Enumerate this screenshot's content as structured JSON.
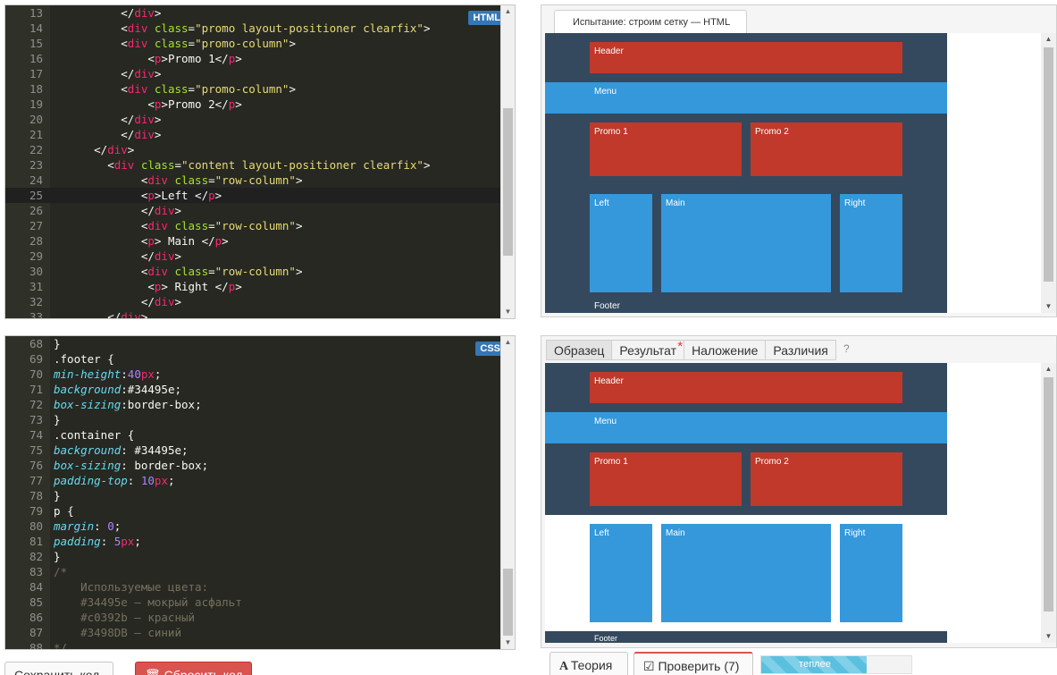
{
  "html_editor": {
    "badge": "HTML",
    "lines": [
      {
        "n": "13",
        "tokens": [
          [
            "t-text",
            "          </"
          ],
          [
            "t-tag",
            "div"
          ],
          [
            "t-text",
            ">"
          ]
        ]
      },
      {
        "n": "14",
        "tokens": [
          [
            "t-text",
            "          <"
          ],
          [
            "t-tag",
            "div"
          ],
          [
            "t-text",
            " "
          ],
          [
            "t-attr",
            "class"
          ],
          [
            "t-text",
            "="
          ],
          [
            "t-str",
            "\"promo layout-positioner clearfix\""
          ],
          [
            "t-text",
            ">"
          ]
        ]
      },
      {
        "n": "15",
        "tokens": [
          [
            "t-text",
            "          <"
          ],
          [
            "t-tag",
            "div"
          ],
          [
            "t-text",
            " "
          ],
          [
            "t-attr",
            "class"
          ],
          [
            "t-text",
            "="
          ],
          [
            "t-str",
            "\"promo-column\""
          ],
          [
            "t-text",
            ">"
          ]
        ]
      },
      {
        "n": "16",
        "tokens": [
          [
            "t-text",
            "              <"
          ],
          [
            "t-tag",
            "p"
          ],
          [
            "t-text",
            ">Promo 1</"
          ],
          [
            "t-tag",
            "p"
          ],
          [
            "t-text",
            ">"
          ]
        ]
      },
      {
        "n": "17",
        "tokens": [
          [
            "t-text",
            "          </"
          ],
          [
            "t-tag",
            "div"
          ],
          [
            "t-text",
            ">"
          ]
        ]
      },
      {
        "n": "18",
        "tokens": [
          [
            "t-text",
            "          <"
          ],
          [
            "t-tag",
            "div"
          ],
          [
            "t-text",
            " "
          ],
          [
            "t-attr",
            "class"
          ],
          [
            "t-text",
            "="
          ],
          [
            "t-str",
            "\"promo-column\""
          ],
          [
            "t-text",
            ">"
          ]
        ]
      },
      {
        "n": "19",
        "tokens": [
          [
            "t-text",
            "              <"
          ],
          [
            "t-tag",
            "p"
          ],
          [
            "t-text",
            ">Promo 2</"
          ],
          [
            "t-tag",
            "p"
          ],
          [
            "t-text",
            ">"
          ]
        ]
      },
      {
        "n": "20",
        "tokens": [
          [
            "t-text",
            "          </"
          ],
          [
            "t-tag",
            "div"
          ],
          [
            "t-text",
            ">"
          ]
        ]
      },
      {
        "n": "21",
        "tokens": [
          [
            "t-text",
            "          </"
          ],
          [
            "t-tag",
            "div"
          ],
          [
            "t-text",
            ">"
          ]
        ]
      },
      {
        "n": "22",
        "tokens": [
          [
            "t-text",
            "      </"
          ],
          [
            "t-tag",
            "div"
          ],
          [
            "t-text",
            ">"
          ]
        ]
      },
      {
        "n": "23",
        "tokens": [
          [
            "t-text",
            "        <"
          ],
          [
            "t-tag",
            "div"
          ],
          [
            "t-text",
            " "
          ],
          [
            "t-attr",
            "class"
          ],
          [
            "t-text",
            "="
          ],
          [
            "t-str",
            "\"content layout-positioner clearfix\""
          ],
          [
            "t-text",
            ">"
          ]
        ]
      },
      {
        "n": "24",
        "tokens": [
          [
            "t-text",
            "             <"
          ],
          [
            "t-tag",
            "div"
          ],
          [
            "t-text",
            " "
          ],
          [
            "t-attr",
            "class"
          ],
          [
            "t-text",
            "="
          ],
          [
            "t-str",
            "\"row-column\""
          ],
          [
            "t-text",
            ">"
          ]
        ]
      },
      {
        "n": "25",
        "tokens": [
          [
            "t-text",
            "             <"
          ],
          [
            "t-tag",
            "p"
          ],
          [
            "t-text",
            ">Left </"
          ],
          [
            "t-tag",
            "p"
          ],
          [
            "t-text",
            ">"
          ]
        ],
        "active": true
      },
      {
        "n": "26",
        "tokens": [
          [
            "t-text",
            "             </"
          ],
          [
            "t-tag",
            "div"
          ],
          [
            "t-text",
            ">"
          ]
        ]
      },
      {
        "n": "27",
        "tokens": [
          [
            "t-text",
            "             <"
          ],
          [
            "t-tag",
            "div"
          ],
          [
            "t-text",
            " "
          ],
          [
            "t-attr",
            "class"
          ],
          [
            "t-text",
            "="
          ],
          [
            "t-str",
            "\"row-column\""
          ],
          [
            "t-text",
            ">"
          ]
        ]
      },
      {
        "n": "28",
        "tokens": [
          [
            "t-text",
            "             <"
          ],
          [
            "t-tag",
            "p"
          ],
          [
            "t-text",
            "> Main </"
          ],
          [
            "t-tag",
            "p"
          ],
          [
            "t-text",
            ">"
          ]
        ]
      },
      {
        "n": "29",
        "tokens": [
          [
            "t-text",
            "             </"
          ],
          [
            "t-tag",
            "div"
          ],
          [
            "t-text",
            ">"
          ]
        ]
      },
      {
        "n": "30",
        "tokens": [
          [
            "t-text",
            "             <"
          ],
          [
            "t-tag",
            "div"
          ],
          [
            "t-text",
            " "
          ],
          [
            "t-attr",
            "class"
          ],
          [
            "t-text",
            "="
          ],
          [
            "t-str",
            "\"row-column\""
          ],
          [
            "t-text",
            ">"
          ]
        ]
      },
      {
        "n": "31",
        "tokens": [
          [
            "t-text",
            "              <"
          ],
          [
            "t-tag",
            "p"
          ],
          [
            "t-text",
            "> Right </"
          ],
          [
            "t-tag",
            "p"
          ],
          [
            "t-text",
            ">"
          ]
        ]
      },
      {
        "n": "32",
        "tokens": [
          [
            "t-text",
            "             </"
          ],
          [
            "t-tag",
            "div"
          ],
          [
            "t-text",
            ">"
          ]
        ]
      },
      {
        "n": "33",
        "tokens": [
          [
            "t-text",
            "        </"
          ],
          [
            "t-tag",
            "div"
          ],
          [
            "t-text",
            ">"
          ]
        ]
      }
    ]
  },
  "css_editor": {
    "badge": "CSS",
    "lines": [
      {
        "n": "68",
        "tokens": [
          [
            "t-punc",
            "}"
          ]
        ]
      },
      {
        "n": "69",
        "tokens": [
          [
            "t-sel",
            ".footer "
          ],
          [
            "t-punc",
            "{"
          ]
        ]
      },
      {
        "n": "70",
        "tokens": [
          [
            "t-prop",
            "min-height"
          ],
          [
            "t-punc",
            ":"
          ],
          [
            "t-num",
            "40"
          ],
          [
            "t-unit",
            "px"
          ],
          [
            "t-punc",
            ";"
          ]
        ]
      },
      {
        "n": "71",
        "tokens": [
          [
            "t-prop",
            "background"
          ],
          [
            "t-punc",
            ":"
          ],
          [
            "t-val",
            "#34495e"
          ],
          [
            "t-punc",
            ";"
          ]
        ]
      },
      {
        "n": "72",
        "tokens": [
          [
            "t-prop",
            "box-sizing"
          ],
          [
            "t-punc",
            ":"
          ],
          [
            "t-val",
            "border-box"
          ],
          [
            "t-punc",
            ";"
          ]
        ]
      },
      {
        "n": "73",
        "tokens": [
          [
            "t-punc",
            "}"
          ]
        ]
      },
      {
        "n": "74",
        "tokens": [
          [
            "t-sel",
            ".container "
          ],
          [
            "t-punc",
            "{"
          ]
        ]
      },
      {
        "n": "75",
        "tokens": [
          [
            "t-prop",
            "background"
          ],
          [
            "t-punc",
            ": "
          ],
          [
            "t-val",
            "#34495e"
          ],
          [
            "t-punc",
            ";"
          ]
        ]
      },
      {
        "n": "76",
        "tokens": [
          [
            "t-prop",
            "box-sizing"
          ],
          [
            "t-punc",
            ": "
          ],
          [
            "t-val",
            "border-box"
          ],
          [
            "t-punc",
            ";"
          ]
        ]
      },
      {
        "n": "77",
        "tokens": [
          [
            "t-prop",
            "padding-top"
          ],
          [
            "t-punc",
            ": "
          ],
          [
            "t-num",
            "10"
          ],
          [
            "t-unit",
            "px"
          ],
          [
            "t-punc",
            ";"
          ]
        ]
      },
      {
        "n": "78",
        "tokens": [
          [
            "t-punc",
            "}"
          ]
        ]
      },
      {
        "n": "79",
        "tokens": [
          [
            "t-sel",
            "p "
          ],
          [
            "t-punc",
            "{"
          ]
        ]
      },
      {
        "n": "80",
        "tokens": [
          [
            "t-prop",
            "margin"
          ],
          [
            "t-punc",
            ": "
          ],
          [
            "t-num",
            "0"
          ],
          [
            "t-punc",
            ";"
          ]
        ]
      },
      {
        "n": "81",
        "tokens": [
          [
            "t-prop",
            "padding"
          ],
          [
            "t-punc",
            ": "
          ],
          [
            "t-num",
            "5"
          ],
          [
            "t-unit",
            "px"
          ],
          [
            "t-punc",
            ";"
          ]
        ]
      },
      {
        "n": "82",
        "tokens": [
          [
            "t-punc",
            "}"
          ]
        ]
      },
      {
        "n": "83",
        "tokens": [
          [
            "t-comment",
            "/*"
          ]
        ]
      },
      {
        "n": "84",
        "tokens": [
          [
            "t-comment",
            "    Используемые цвета:"
          ]
        ]
      },
      {
        "n": "85",
        "tokens": [
          [
            "t-comment",
            "    #34495e – мокрый асфальт"
          ]
        ]
      },
      {
        "n": "86",
        "tokens": [
          [
            "t-comment",
            "    #c0392b – красный"
          ]
        ]
      },
      {
        "n": "87",
        "tokens": [
          [
            "t-comment",
            "    #3498DB – синий"
          ]
        ]
      },
      {
        "n": "88",
        "tokens": [
          [
            "t-comment",
            "*/"
          ]
        ]
      }
    ]
  },
  "preview_top": {
    "tab_title": "Испытание: строим сетку — HTML",
    "blocks": {
      "header": "Header",
      "menu": "Menu",
      "promo1": "Promo 1",
      "promo2": "Promo 2",
      "left": "Left",
      "main": "Main",
      "right": "Right",
      "footer": "Footer"
    }
  },
  "preview_bottom": {
    "tabs": [
      {
        "label": "Образец",
        "active": true
      },
      {
        "label": "Результат",
        "starred": true
      },
      {
        "label": "Наложение"
      },
      {
        "label": "Различия"
      }
    ],
    "help": "?",
    "blocks": {
      "header": "Header",
      "menu": "Menu",
      "promo1": "Promo 1",
      "promo2": "Promo 2",
      "left": "Left",
      "main": "Main",
      "right": "Right",
      "footer": "Footer"
    }
  },
  "actions": {
    "save": "Сохранить код",
    "reset": "Сбросить код",
    "theory": "Теория",
    "check": "Проверить (7)",
    "progress_label": "теплее",
    "progress_fraction": 0.7
  },
  "colors": {
    "dark": "#34495e",
    "red": "#c0392b",
    "blue": "#3498db"
  }
}
